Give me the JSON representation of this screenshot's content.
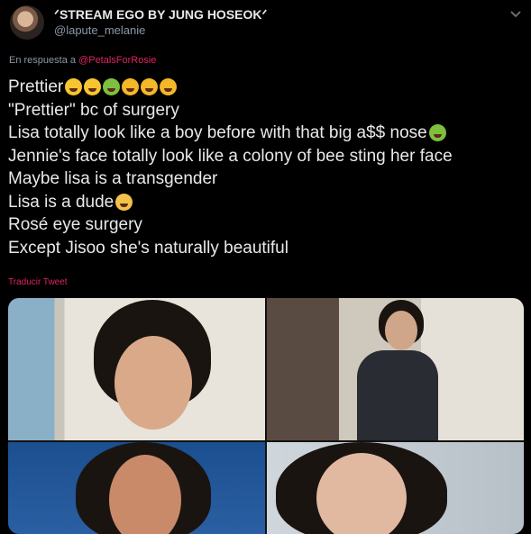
{
  "author": {
    "name": "ᐟSTREAM EGO BY JUNG HOSEOKᐟ",
    "handle": "@lapute_melanie"
  },
  "reply_context": {
    "prefix": "En respuesta a",
    "mention": "@PetalsForRosie"
  },
  "tweet": {
    "lines": [
      "Prettier",
      "\"Prettier\" bc of surgery",
      "Lisa totally look like a boy before with that big a$$ nose",
      " Jennie's face totally look like a colony of bee sting her face",
      "Maybe lisa is a transgender",
      "Lisa is a dude",
      "Rosé eye surgery",
      "Except Jisoo she's naturally beautiful"
    ],
    "translate_label": "Traducir Tweet"
  },
  "colors": {
    "background": "#000000",
    "text": "#e7e9ea",
    "secondary": "#8b98a5",
    "accent": "#e0245e"
  },
  "icons": [
    "chevron-down-icon",
    "crying-emoji",
    "nauseated-emoji",
    "laughing-emoji",
    "screaming-emoji"
  ]
}
